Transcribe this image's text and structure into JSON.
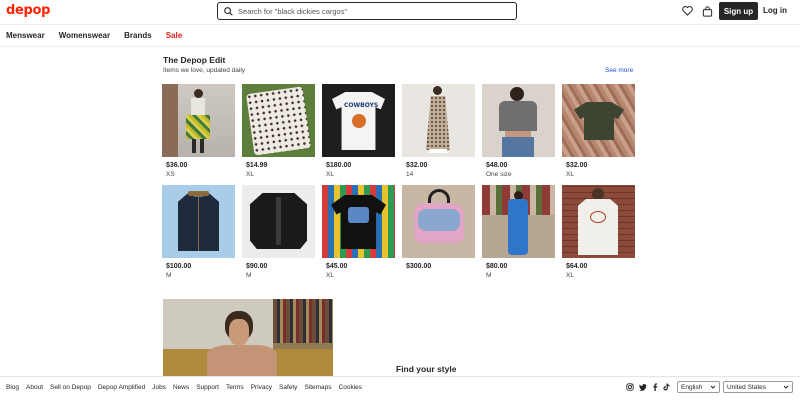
{
  "header": {
    "logo": "depop",
    "search_placeholder": "Search for \"black dickies cargos\"",
    "signup_label": "Sign up",
    "login_label": "Log in"
  },
  "nav": {
    "items": [
      "Menswear",
      "Womenswear",
      "Brands",
      "Sale"
    ]
  },
  "edit": {
    "title": "The Depop Edit",
    "subtitle": "Items we love, updated daily",
    "see_more": "See more",
    "items": [
      {
        "price": "$36.00",
        "size": "XS"
      },
      {
        "price": "$14.99",
        "size": "XL"
      },
      {
        "price": "$180.00",
        "size": "XL"
      },
      {
        "price": "$32.00",
        "size": "14"
      },
      {
        "price": "$48.00",
        "size": "One size"
      },
      {
        "price": "$32.00",
        "size": "XL"
      },
      {
        "price": "$100.00",
        "size": "M"
      },
      {
        "price": "$90.00",
        "size": "M"
      },
      {
        "price": "$45.00",
        "size": "XL"
      },
      {
        "price": "$300.00",
        "size": ""
      },
      {
        "price": "$80.00",
        "size": "M"
      },
      {
        "price": "$64.00",
        "size": "XL"
      }
    ]
  },
  "find_style": {
    "title": "Find your style"
  },
  "footer": {
    "links": [
      "Blog",
      "About",
      "Sell on Depop",
      "Depop Amplified",
      "Jobs",
      "News",
      "Support",
      "Terms",
      "Privacy",
      "Safety",
      "Sitemaps",
      "Cookies"
    ],
    "language": "English",
    "country": "United States"
  },
  "colors": {
    "brand": "#ff2300",
    "sale": "#e0201b",
    "link": "#1f4fd4",
    "dark": "#262626"
  }
}
